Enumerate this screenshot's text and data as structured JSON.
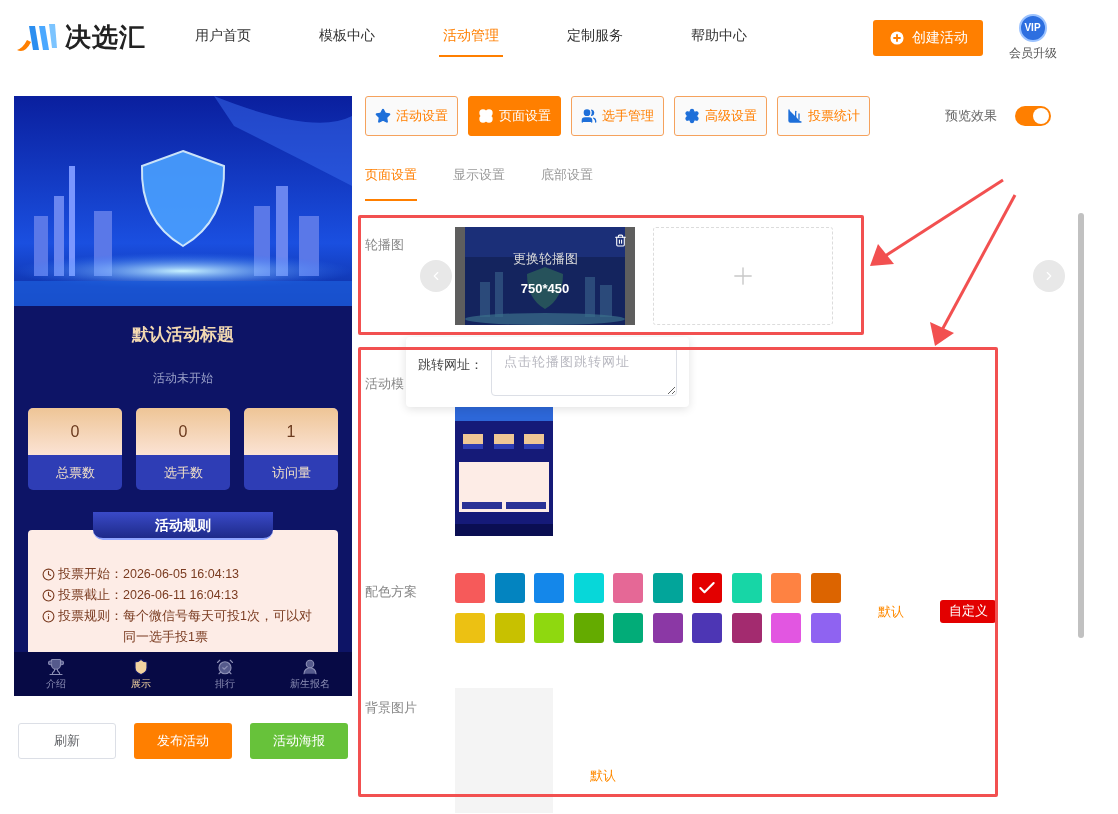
{
  "header": {
    "logo_text": "决选汇",
    "nav": [
      {
        "label": "用户首页",
        "selected": false
      },
      {
        "label": "模板中心",
        "selected": false
      },
      {
        "label": "活动管理",
        "selected": true
      },
      {
        "label": "定制服务",
        "selected": false
      },
      {
        "label": "帮助中心",
        "selected": false
      }
    ],
    "create_button": "创建活动",
    "vip_badge": "VIP",
    "vip_label": "会员升级"
  },
  "preview": {
    "title": "默认活动标题",
    "status": "活动未开始",
    "stats": [
      {
        "value": "0",
        "label": "总票数"
      },
      {
        "value": "0",
        "label": "选手数"
      },
      {
        "value": "1",
        "label": "访问量"
      }
    ],
    "rules_heading": "活动规则",
    "rules": [
      {
        "kind": "clock",
        "label": "投票开始：",
        "value": "2026-06-05 16:04:13"
      },
      {
        "kind": "clock",
        "label": "投票截止：",
        "value": "2026-06-11 16:04:13"
      },
      {
        "kind": "info",
        "label": "投票规则：",
        "value": "每个微信号每天可投1次，可以对同一选手投1票"
      }
    ],
    "nav": [
      {
        "label": "介绍",
        "selected": false
      },
      {
        "label": "展示",
        "selected": true
      },
      {
        "label": "排行",
        "selected": false
      },
      {
        "label": "新生报名",
        "selected": false
      }
    ]
  },
  "actions": [
    {
      "label": "刷新",
      "kind": "outline"
    },
    {
      "label": "发布活动",
      "kind": "primary"
    },
    {
      "label": "活动海报",
      "kind": "success"
    }
  ],
  "toolbar": [
    {
      "label": "活动设置",
      "selected": false
    },
    {
      "label": "页面设置",
      "selected": true
    },
    {
      "label": "选手管理",
      "selected": false
    },
    {
      "label": "高级设置",
      "selected": false
    },
    {
      "label": "投票统计",
      "selected": false
    }
  ],
  "preview_toggle": {
    "label": "预览效果",
    "on": true
  },
  "subtabs": [
    {
      "label": "页面设置",
      "selected": true
    },
    {
      "label": "显示设置",
      "selected": false
    },
    {
      "label": "底部设置",
      "selected": false
    }
  ],
  "carousel": {
    "label": "轮播图",
    "replace_text": "更换轮播图",
    "size_text": "750*450"
  },
  "link_popover": {
    "label": "跳转网址：",
    "placeholder": "点击轮播图跳转网址"
  },
  "template": {
    "label": "活动模"
  },
  "color_scheme": {
    "label": "配色方案",
    "default_label": "默认",
    "custom_button": "自定义",
    "swatches": [
      {
        "color": "#f65a5a",
        "selected": false
      },
      {
        "color": "#0384c0",
        "selected": false
      },
      {
        "color": "#1487ea",
        "selected": false
      },
      {
        "color": "#07d7d9",
        "selected": false
      },
      {
        "color": "#e56896",
        "selected": false
      },
      {
        "color": "#02a59a",
        "selected": false
      },
      {
        "color": "#e30000",
        "selected": true
      },
      {
        "color": "#17d6a6",
        "selected": false
      },
      {
        "color": "#fe8242",
        "selected": false
      },
      {
        "color": "#dc6400",
        "selected": false
      },
      {
        "color": "#ecc113",
        "selected": false
      },
      {
        "color": "#c8c100",
        "selected": false
      },
      {
        "color": "#8fd80f",
        "selected": false
      },
      {
        "color": "#64ab00",
        "selected": false
      },
      {
        "color": "#02ac78",
        "selected": false
      },
      {
        "color": "#8b38a5",
        "selected": false
      },
      {
        "color": "#4d36b4",
        "selected": false
      },
      {
        "color": "#a32b6f",
        "selected": false
      },
      {
        "color": "#e256e1",
        "selected": false
      },
      {
        "color": "#8f63f1",
        "selected": false
      }
    ]
  },
  "background": {
    "label": "背景图片",
    "default_label": "默认"
  }
}
